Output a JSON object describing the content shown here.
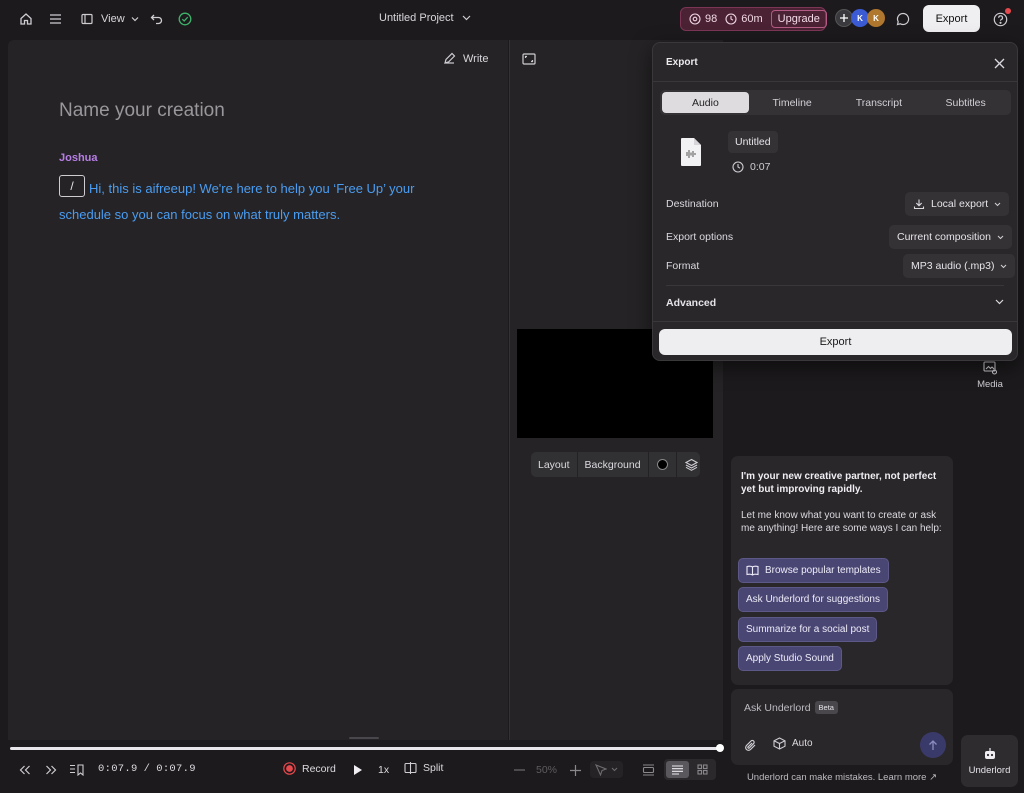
{
  "topbar": {
    "view_label": "View",
    "project_title": "Untitled Project",
    "credits_eye": "98",
    "credits_time": "60m",
    "upgrade_label": "Upgrade",
    "avatars": [
      "K",
      "K"
    ],
    "export_label": "Export"
  },
  "editor": {
    "write_label": "Write",
    "title_placeholder": "Name your creation",
    "speaker": "Joshua",
    "slash": "/",
    "script_text": "Hi, this is aifreeup! We're here to help you ‘Free Up’ your schedule so you can focus on what truly matters."
  },
  "export_dialog": {
    "title": "Export",
    "tabs": [
      "Audio",
      "Timeline",
      "Transcript",
      "Subtitles"
    ],
    "active_tab": "Audio",
    "file_name": "Untitled",
    "duration": "0:07",
    "destination_label": "Destination",
    "destination_value": "Local export",
    "options_label": "Export options",
    "options_value": "Current composition",
    "format_label": "Format",
    "format_value": "MP3 audio (.mp3)",
    "advanced_label": "Advanced",
    "export_button": "Export"
  },
  "preview": {
    "layout_label": "Layout",
    "background_label": "Background"
  },
  "right_rail": {
    "media_label": "Media",
    "underlord_label": "Underlord"
  },
  "chat": {
    "intro_bold": "I'm your new creative partner, not perfect yet but improving rapidly.",
    "intro_text": "Let me know what you want to create or ask me anything! Here are some ways I can help:",
    "suggestions": [
      "Browse popular templates",
      "Ask Underlord for suggestions",
      "Summarize for a social post",
      "Apply Studio Sound"
    ],
    "ask_placeholder": "Ask Underlord",
    "beta_badge": "Beta",
    "mode_label": "Auto",
    "disclaimer": "Underlord can make mistakes. Learn more ↗"
  },
  "timeline": {
    "time_current": "0:07.9",
    "time_sep": "/",
    "time_total": "0:07.9",
    "record_label": "Record",
    "speed_label": "1x",
    "split_label": "Split",
    "zoom_label": "50%",
    "progress": 1.0
  },
  "colors": {
    "accent_purple": "#b77ee6",
    "script_blue": "#4a9df2",
    "record_red": "#e5484d",
    "credits_bg": "#4a2234",
    "chip_bg": "#4a4673"
  }
}
